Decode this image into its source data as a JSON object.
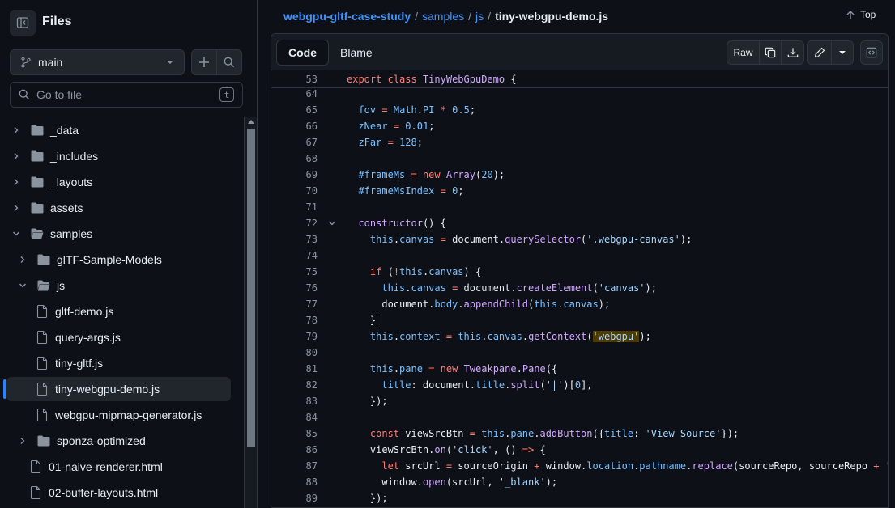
{
  "sidebar": {
    "title": "Files",
    "branch": "main",
    "goto_placeholder": "Go to file",
    "goto_shortcut": "t",
    "items": [
      {
        "label": "_data",
        "type": "folder",
        "depth": 0,
        "expanded": false
      },
      {
        "label": "_includes",
        "type": "folder",
        "depth": 0,
        "expanded": false
      },
      {
        "label": "_layouts",
        "type": "folder",
        "depth": 0,
        "expanded": false
      },
      {
        "label": "assets",
        "type": "folder",
        "depth": 0,
        "expanded": false
      },
      {
        "label": "samples",
        "type": "folder",
        "depth": 0,
        "expanded": true
      },
      {
        "label": "glTF-Sample-Models",
        "type": "folder",
        "depth": 1,
        "expanded": false
      },
      {
        "label": "js",
        "type": "folder",
        "depth": 1,
        "expanded": true
      },
      {
        "label": "gltf-demo.js",
        "type": "file",
        "depth": 2
      },
      {
        "label": "query-args.js",
        "type": "file",
        "depth": 2
      },
      {
        "label": "tiny-gltf.js",
        "type": "file",
        "depth": 2
      },
      {
        "label": "tiny-webgpu-demo.js",
        "type": "file",
        "depth": 2,
        "selected": true
      },
      {
        "label": "webgpu-mipmap-generator.js",
        "type": "file",
        "depth": 2
      },
      {
        "label": "sponza-optimized",
        "type": "folder",
        "depth": 1,
        "expanded": false
      },
      {
        "label": "01-naive-renderer.html",
        "type": "file",
        "depth": 1
      },
      {
        "label": "02-buffer-layouts.html",
        "type": "file",
        "depth": 1
      }
    ]
  },
  "breadcrumb": {
    "repo": "webgpu-gltf-case-study",
    "parts": [
      "samples",
      "js"
    ],
    "current": "tiny-webgpu-demo.js"
  },
  "top_label": "Top",
  "toolbar": {
    "code_tab": "Code",
    "blame_tab": "Blame",
    "raw_label": "Raw"
  },
  "sticky": {
    "line": "53",
    "html": "<span class=\"k\">export</span> <span class=\"k\">class</span> <span class=\"f\">TinyWebGpuDemo</span> {"
  },
  "code": [
    {
      "n": "64",
      "html": ""
    },
    {
      "n": "65",
      "html": "  <span class=\"p\">fov</span> <span class=\"k\">=</span> <span class=\"p\">Math</span>.<span class=\"p\">PI</span> <span class=\"k\">*</span> <span class=\"p\">0.5</span>;"
    },
    {
      "n": "66",
      "html": "  <span class=\"p\">zNear</span> <span class=\"k\">=</span> <span class=\"p\">0.01</span>;"
    },
    {
      "n": "67",
      "html": "  <span class=\"p\">zFar</span> <span class=\"k\">=</span> <span class=\"p\">128</span>;"
    },
    {
      "n": "68",
      "html": ""
    },
    {
      "n": "69",
      "html": "  <span class=\"p\">#frameMs</span> <span class=\"k\">=</span> <span class=\"k\">new</span> <span class=\"f\">Array</span>(<span class=\"p\">20</span>);"
    },
    {
      "n": "70",
      "html": "  <span class=\"p\">#frameMsIndex</span> <span class=\"k\">=</span> <span class=\"p\">0</span>;"
    },
    {
      "n": "71",
      "html": ""
    },
    {
      "n": "72",
      "html": "  <span class=\"f\">constructor</span>() {",
      "fold": true
    },
    {
      "n": "73",
      "html": "    <span class=\"p\">this</span>.<span class=\"p\">canvas</span> <span class=\"k\">=</span> document.<span class=\"f\">querySelector</span>(<span class=\"s\">'.webgpu-canvas'</span>);"
    },
    {
      "n": "74",
      "html": ""
    },
    {
      "n": "75",
      "html": "    <span class=\"k\">if</span> (<span class=\"k\">!</span><span class=\"p\">this</span>.<span class=\"p\">canvas</span>) {"
    },
    {
      "n": "76",
      "html": "      <span class=\"p\">this</span>.<span class=\"p\">canvas</span> <span class=\"k\">=</span> document.<span class=\"f\">createElement</span>(<span class=\"s\">'canvas'</span>);"
    },
    {
      "n": "77",
      "html": "      document.<span class=\"p\">body</span>.<span class=\"f\">appendChild</span>(<span class=\"p\">this</span>.<span class=\"p\">canvas</span>);"
    },
    {
      "n": "78",
      "html": "    }<span class=\"cursor\"></span>"
    },
    {
      "n": "79",
      "html": "    <span class=\"p\">this</span>.<span class=\"p\">context</span> <span class=\"k\">=</span> <span class=\"p\">this</span>.<span class=\"p\">canvas</span>.<span class=\"f\">getContext</span>(<span class=\"s hl\">'webgpu'</span>);"
    },
    {
      "n": "80",
      "html": ""
    },
    {
      "n": "81",
      "html": "    <span class=\"p\">this</span>.<span class=\"p\">pane</span> <span class=\"k\">=</span> <span class=\"k\">new</span> <span class=\"f\">Tweakpane</span>.<span class=\"f\">Pane</span>({"
    },
    {
      "n": "82",
      "html": "      <span class=\"p\">title</span>: document.<span class=\"p\">title</span>.<span class=\"f\">split</span>(<span class=\"s\">'|'</span>)[<span class=\"p\">0</span>],"
    },
    {
      "n": "83",
      "html": "    });"
    },
    {
      "n": "84",
      "html": ""
    },
    {
      "n": "85",
      "html": "    <span class=\"k\">const</span> viewSrcBtn <span class=\"k\">=</span> <span class=\"p\">this</span>.<span class=\"p\">pane</span>.<span class=\"f\">addButton</span>({<span class=\"p\">title</span>: <span class=\"s\">'View Source'</span>});"
    },
    {
      "n": "86",
      "html": "    viewSrcBtn.<span class=\"f\">on</span>(<span class=\"s\">'click'</span>, () <span class=\"k\">=&gt;</span> {"
    },
    {
      "n": "87",
      "html": "      <span class=\"k\">let</span> srcUrl <span class=\"k\">=</span> sourceOrigin <span class=\"k\">+</span> window.<span class=\"p\">location</span>.<span class=\"p\">pathname</span>.<span class=\"f\">replace</span>(sourceRepo, sourceRepo <span class=\"k\">+</span> <span class=\"s\">'</span>"
    },
    {
      "n": "88",
      "html": "      window.<span class=\"f\">open</span>(srcUrl, <span class=\"s\">'_blank'</span>);"
    },
    {
      "n": "89",
      "html": "    });"
    }
  ]
}
